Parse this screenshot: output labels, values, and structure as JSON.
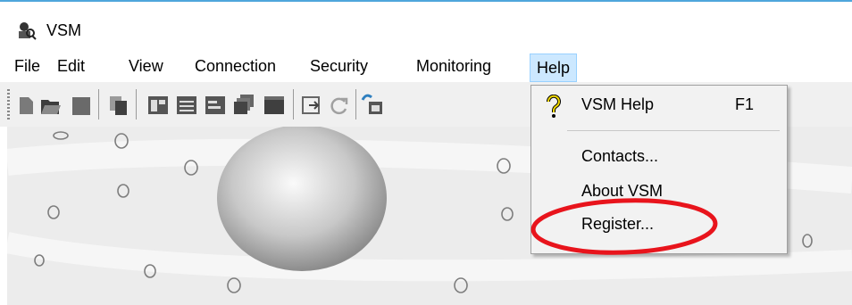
{
  "window": {
    "title": "VSM",
    "icon": "vsm-app-icon"
  },
  "menubar": {
    "items": [
      {
        "label": "File"
      },
      {
        "label": "Edit"
      },
      {
        "label": "View"
      },
      {
        "label": "Connection"
      },
      {
        "label": "Security"
      },
      {
        "label": "Monitoring"
      },
      {
        "label": "Help"
      }
    ]
  },
  "toolbar": {
    "buttons": [
      "new-icon",
      "open-folder-icon",
      "save-icon",
      "copy-icon",
      "grid-view-icon",
      "table-view-icon",
      "list-view-icon",
      "cascade-windows-icon",
      "window-icon",
      "export-icon",
      "refresh-icon",
      "connect-icon"
    ]
  },
  "help_menu": {
    "items": [
      {
        "label": "VSM Help",
        "shortcut": "F1",
        "icon": "help-icon"
      },
      {
        "label": "Contacts..."
      },
      {
        "label": "About VSM"
      },
      {
        "label": "Register..."
      }
    ]
  },
  "colors": {
    "menu_highlight": "#cce8ff",
    "annotation": "#e8141c"
  }
}
